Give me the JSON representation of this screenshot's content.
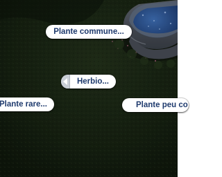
{
  "pie_menu": {
    "center_option": "Herbio...",
    "options": {
      "top": "Plante commune...",
      "left": "Plante rare...",
      "right": "Plante peu co"
    }
  },
  "colors": {
    "button_background": "#ffffff",
    "button_text": "#1f3b6e",
    "back_tab": "#c9ced6",
    "grass_dark": "#15200f",
    "fountain_water": "#2a4f8c"
  },
  "icons": {
    "back": "back-arrow-icon"
  }
}
